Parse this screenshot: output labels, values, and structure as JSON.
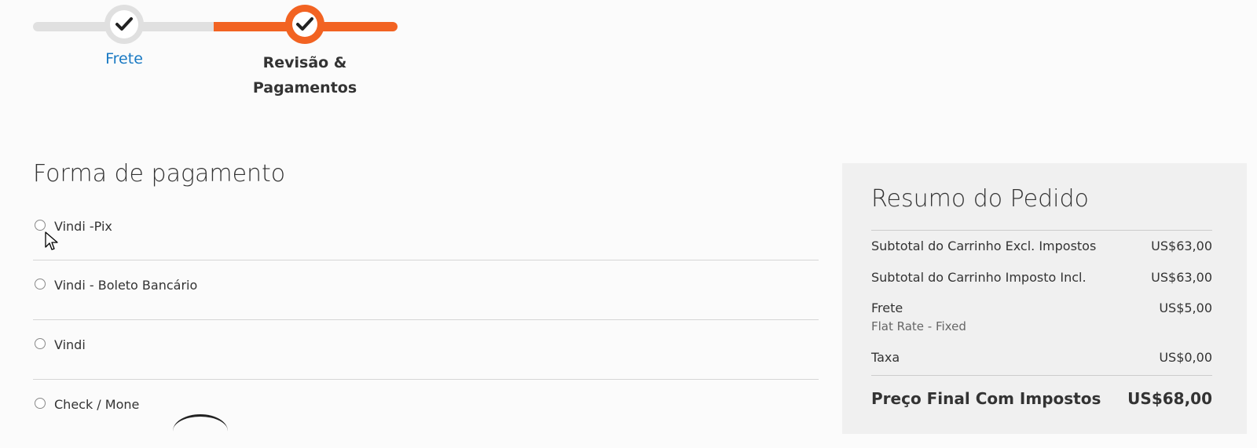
{
  "progress": {
    "steps": [
      {
        "label": "Frete",
        "status": "complete"
      },
      {
        "label": "Revisão & Pagamentos",
        "status": "active"
      }
    ],
    "colors": {
      "active": "#f26322",
      "inactive": "#e0e0e0",
      "link": "#1979c3"
    }
  },
  "payment": {
    "title": "Forma de pagamento",
    "options": [
      {
        "label": "Vindi -Pix"
      },
      {
        "label": "Vindi - Boleto Bancário"
      },
      {
        "label": "Vindi"
      },
      {
        "label": "Check / Mone"
      }
    ]
  },
  "summary": {
    "title": "Resumo do Pedido",
    "rows": [
      {
        "label": "Subtotal do Carrinho Excl. Impostos",
        "amount": "US$63,00"
      },
      {
        "label": "Subtotal do Carrinho Imposto Incl.",
        "amount": "US$63,00"
      },
      {
        "label": "Frete",
        "amount": "US$5,00",
        "sub": "Flat Rate - Fixed"
      },
      {
        "label": "Taxa",
        "amount": "US$0,00"
      }
    ],
    "grand_total": {
      "label": "Preço Final Com Impostos",
      "amount": "US$68,00"
    }
  }
}
